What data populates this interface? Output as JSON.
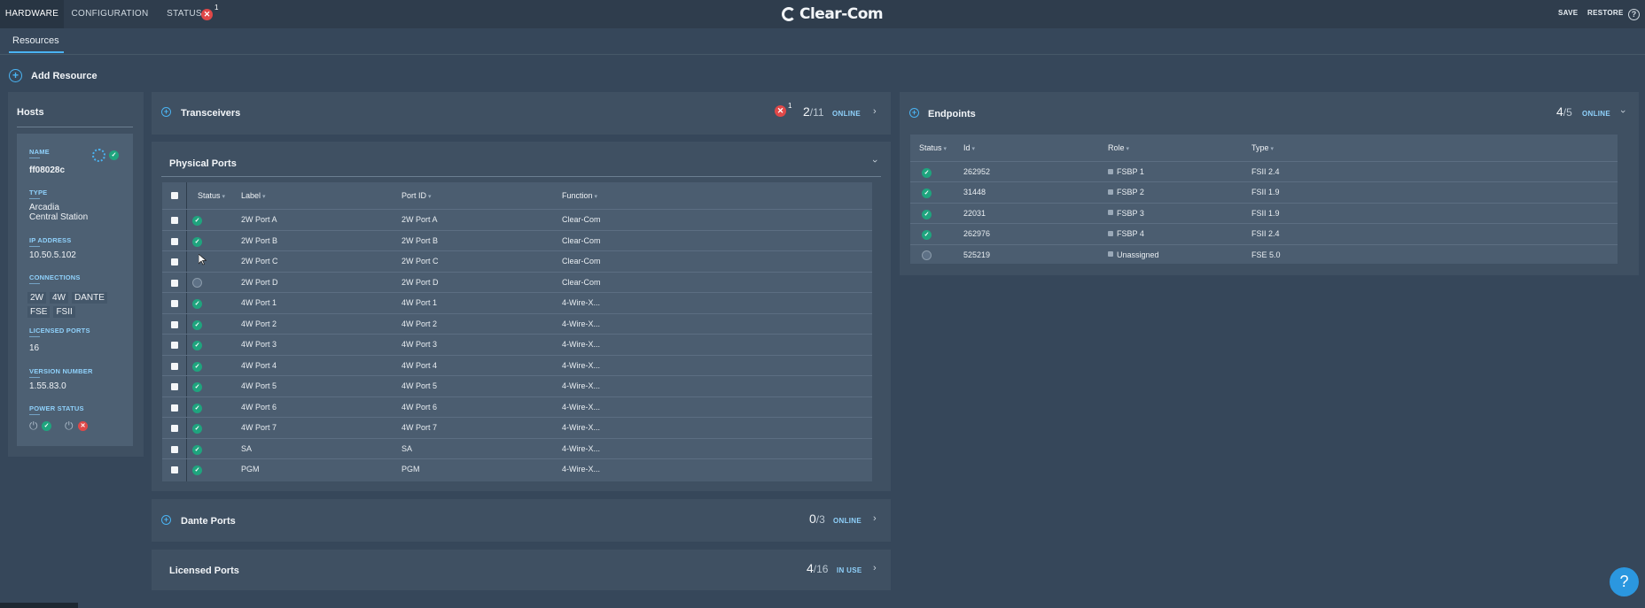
{
  "topbar": {
    "tabs": [
      {
        "label": "HARDWARE"
      },
      {
        "label": "CONFIGURATION"
      },
      {
        "label": "STATUS",
        "badge": "1"
      }
    ],
    "logo": "Clear-Com",
    "save_label": "SAVE",
    "restore_label": "RESTORE"
  },
  "subnav": {
    "active_tab": "Resources"
  },
  "add_resource": {
    "label": "Add Resource"
  },
  "hosts": {
    "title": "Hosts",
    "name_label": "NAME",
    "name": "ff08028c",
    "type_label": "TYPE",
    "type_line1": "Arcadia",
    "type_line2": "Central Station",
    "ip_label": "IP ADDRESS",
    "ip": "10.50.5.102",
    "connections_label": "CONNECTIONS",
    "connections": [
      "2W",
      "4W",
      "DANTE",
      "FSE",
      "FSII"
    ],
    "licensed_label": "LICENSED PORTS",
    "licensed_ports": "16",
    "version_label": "VERSION NUMBER",
    "version": "1.55.83.0",
    "power_label": "POWER STATUS"
  },
  "transceivers": {
    "title": "Transceivers",
    "error_badge": "1",
    "online": "2",
    "total": "/11",
    "status_label": "ONLINE"
  },
  "physical_ports": {
    "title": "Physical Ports",
    "columns": [
      "Status",
      "Label",
      "Port ID",
      "Function"
    ],
    "rows": [
      {
        "status": "ok",
        "label": "2W Port A",
        "port_id": "2W Port A",
        "function": "Clear-Com"
      },
      {
        "status": "ok",
        "label": "2W Port B",
        "port_id": "2W Port B",
        "function": "Clear-Com"
      },
      {
        "status": "none",
        "label": "2W Port C",
        "port_id": "2W Port C",
        "function": "Clear-Com"
      },
      {
        "status": "offline",
        "label": "2W Port D",
        "port_id": "2W Port D",
        "function": "Clear-Com"
      },
      {
        "status": "ok",
        "label": "4W Port 1",
        "port_id": "4W Port 1",
        "function": "4-Wire-X..."
      },
      {
        "status": "ok",
        "label": "4W Port 2",
        "port_id": "4W Port 2",
        "function": "4-Wire-X..."
      },
      {
        "status": "ok",
        "label": "4W Port 3",
        "port_id": "4W Port 3",
        "function": "4-Wire-X..."
      },
      {
        "status": "ok",
        "label": "4W Port 4",
        "port_id": "4W Port 4",
        "function": "4-Wire-X..."
      },
      {
        "status": "ok",
        "label": "4W Port 5",
        "port_id": "4W Port 5",
        "function": "4-Wire-X..."
      },
      {
        "status": "ok",
        "label": "4W Port 6",
        "port_id": "4W Port 6",
        "function": "4-Wire-X..."
      },
      {
        "status": "ok",
        "label": "4W Port 7",
        "port_id": "4W Port 7",
        "function": "4-Wire-X..."
      },
      {
        "status": "ok",
        "label": "SA",
        "port_id": "SA",
        "function": "4-Wire-X..."
      },
      {
        "status": "ok",
        "label": "PGM",
        "port_id": "PGM",
        "function": "4-Wire-X..."
      }
    ]
  },
  "dante_ports": {
    "title": "Dante Ports",
    "online": "0",
    "total": "/3",
    "status_label": "ONLINE"
  },
  "licensed_ports": {
    "title": "Licensed Ports",
    "in_use": "4",
    "total": "/16",
    "status_label": "IN USE"
  },
  "endpoints": {
    "title": "Endpoints",
    "online": "4",
    "total": "/5",
    "status_label": "ONLINE",
    "columns": [
      "Status",
      "Id",
      "Role",
      "Type"
    ],
    "rows": [
      {
        "status": "ok",
        "id": "262952",
        "role": "FSBP 1",
        "type": "FSII 2.4"
      },
      {
        "status": "ok",
        "id": "31448",
        "role": "FSBP 2",
        "type": "FSII 1.9"
      },
      {
        "status": "ok",
        "id": "22031",
        "role": "FSBP 3",
        "type": "FSII 1.9"
      },
      {
        "status": "ok",
        "id": "262976",
        "role": "FSBP 4",
        "type": "FSII 2.4"
      },
      {
        "status": "offline",
        "id": "525219",
        "role": "Unassigned",
        "type": "FSE 5.0"
      }
    ]
  },
  "help": {
    "label": "?"
  },
  "colors": {
    "accent": "#4ab3f2",
    "ok": "#1fa47e",
    "error": "#e04848",
    "background": "#36475a"
  }
}
